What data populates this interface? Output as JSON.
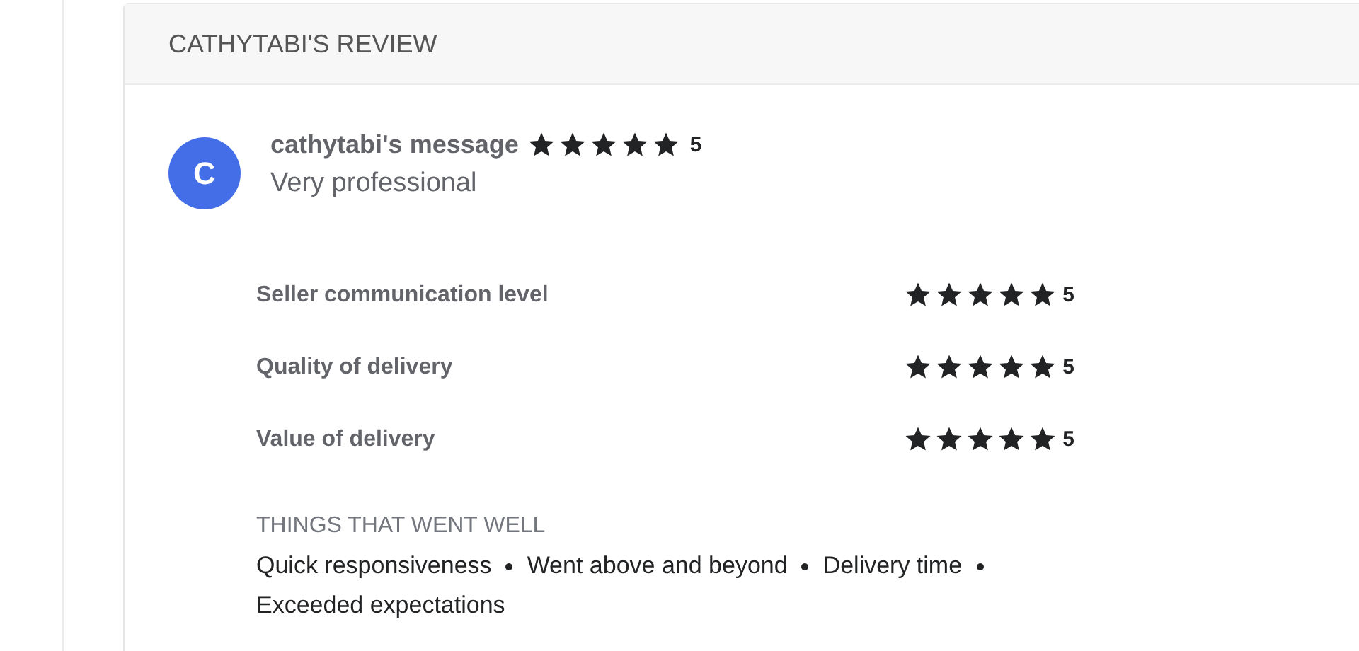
{
  "review": {
    "title": "CATHYTABI'S REVIEW",
    "avatar": {
      "initial": "C",
      "color": "#446ee7"
    },
    "message": {
      "title": "cathytabi's message",
      "stars": 5,
      "rating": "5",
      "text": "Very professional"
    },
    "ratings": [
      {
        "label": "Seller communication level",
        "stars": 5,
        "rating": "5"
      },
      {
        "label": "Quality of delivery",
        "stars": 5,
        "rating": "5"
      },
      {
        "label": "Value of delivery",
        "stars": 5,
        "rating": "5"
      }
    ],
    "highlights": {
      "title": "THINGS THAT WENT WELL",
      "items": [
        "Quick responsiveness",
        "Went above and beyond",
        "Delivery time",
        "Exceeded expectations"
      ]
    }
  }
}
